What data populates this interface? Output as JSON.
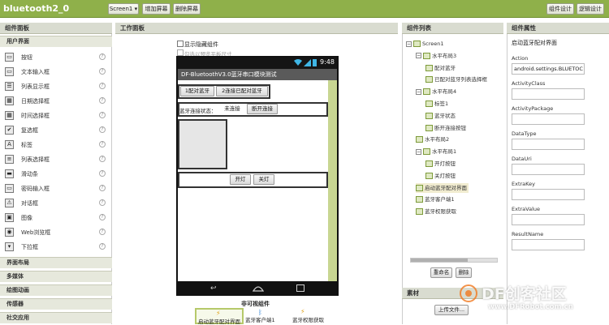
{
  "app": {
    "title": "bluetooth2_0"
  },
  "toolbar": {
    "screen_select": "Screen1 ▾",
    "add_screen": "增加屏幕",
    "remove_screen": "删除屏幕",
    "designer": "组件设计",
    "blocks": "逻辑设计"
  },
  "palette": {
    "header": "组件面板",
    "section_user": "用户界面",
    "items": [
      "按钮",
      "文本输入框",
      "列表显示框",
      "日期选择框",
      "时间选择框",
      "复选框",
      "标签",
      "列表选择框",
      "滑动条",
      "密码输入框",
      "对话框",
      "图像",
      "Web浏览框",
      "下拉框"
    ],
    "sections_bottom": [
      "界面布局",
      "多媒体",
      "绘图动画",
      "传感器",
      "社交应用"
    ]
  },
  "viewer": {
    "header": "工作面板",
    "show_hidden": "显示隐藏组件",
    "tablet_preview": "勾选以预览平板尺寸",
    "status_time": "9:48",
    "app_title": "DF-BluetoothV3.0蓝牙串口模块测试",
    "btn_pair": "1配对蓝牙",
    "btn_paired": "2连接已配对蓝牙",
    "status_label": "蓝牙连接状态：",
    "status_value": "未连接",
    "btn_disconnect": "断开连接",
    "btn_on": "开灯",
    "btn_off": "关灯",
    "nonvisible_title": "非可视组件",
    "nonvisible": [
      "启动蓝牙配对界面",
      "蓝牙客户端1",
      "蓝牙权限获取"
    ]
  },
  "components": {
    "header": "组件列表",
    "tree": [
      {
        "label": "Screen1",
        "level": 0,
        "expand": "−"
      },
      {
        "label": "水平布局3",
        "level": 1,
        "expand": "−"
      },
      {
        "label": "配对蓝牙",
        "level": 2
      },
      {
        "label": "已配对蓝牙列表选择框",
        "level": 2
      },
      {
        "label": "水平布局4",
        "level": 1,
        "expand": "−"
      },
      {
        "label": "标签1",
        "level": 2
      },
      {
        "label": "蓝牙状态",
        "level": 2
      },
      {
        "label": "断开连接按钮",
        "level": 2
      },
      {
        "label": "水平布局2",
        "level": 1
      },
      {
        "label": "水平布局1",
        "level": 1,
        "expand": "−"
      },
      {
        "label": "开灯按钮",
        "level": 2
      },
      {
        "label": "关灯按钮",
        "level": 2
      },
      {
        "label": "启动蓝牙配对界面",
        "level": 1,
        "selected": true
      },
      {
        "label": "蓝牙客户端1",
        "level": 1
      },
      {
        "label": "蓝牙权限获取",
        "level": 1
      }
    ],
    "rename": "重命名",
    "delete": "删除",
    "media_header": "素材",
    "upload": "上传文件..."
  },
  "properties": {
    "header": "组件属性",
    "component_name": "启动蓝牙配对界面",
    "fields": [
      {
        "label": "Action",
        "value": "android.settings.BLUETOC"
      },
      {
        "label": "ActivityClass",
        "value": ""
      },
      {
        "label": "ActivityPackage",
        "value": ""
      },
      {
        "label": "DataType",
        "value": ""
      },
      {
        "label": "DataUri",
        "value": ""
      },
      {
        "label": "ExtraKey",
        "value": ""
      },
      {
        "label": "ExtraValue",
        "value": ""
      },
      {
        "label": "ResultName",
        "value": ""
      }
    ]
  },
  "watermark": {
    "brand": "DF创客社区",
    "url": "www.DFRobot.com.cn"
  }
}
